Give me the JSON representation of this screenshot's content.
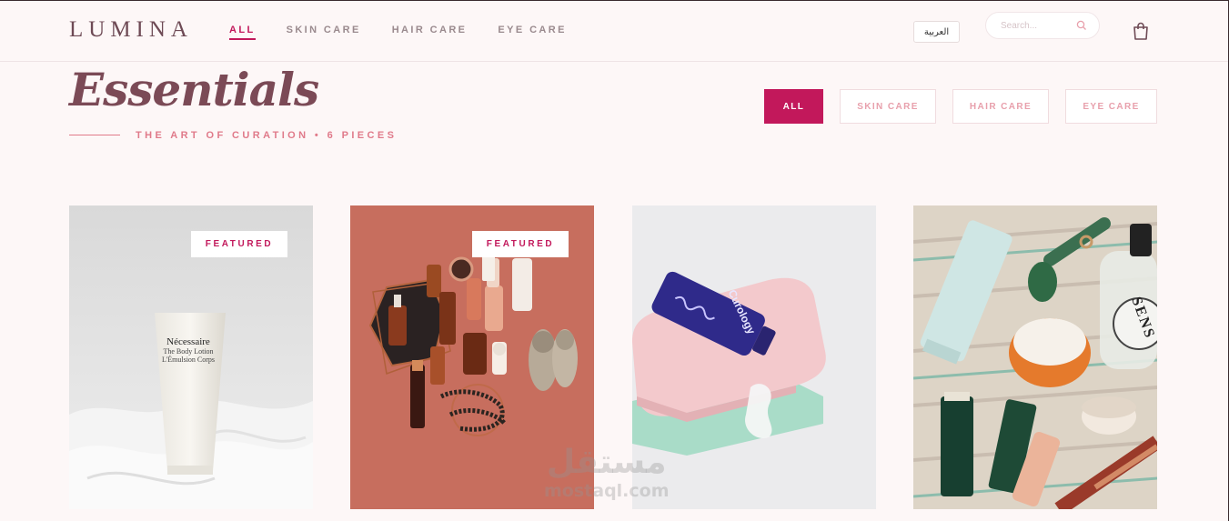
{
  "header": {
    "logo": "LUMINA",
    "nav": [
      "ALL",
      "SKIN CARE",
      "HAIR CARE",
      "EYE CARE"
    ],
    "active_nav": "ALL",
    "language_button": "العربية",
    "search_placeholder": "Search...",
    "icons": {
      "search": "search-icon",
      "cart": "shopping-bag-icon"
    }
  },
  "hero": {
    "title": "Essentials",
    "subtitle": "THE ART OF CURATION • 6 PIECES"
  },
  "filters": [
    "ALL",
    "SKIN CARE",
    "HAIR CARE",
    "EYE CARE"
  ],
  "products": [
    {
      "badge": "FEATURED",
      "image": "white-cream-tube-on-linen",
      "tube_text": [
        "Nécessaire",
        "The Body Lotion",
        "L'Émulsion Corps"
      ]
    },
    {
      "badge": "FEATURED",
      "image": "amber-bottles-flatlay-terracotta"
    },
    {
      "badge": "",
      "image": "blue-serum-bottle-on-pink-tray",
      "bottle_text": "Curology"
    },
    {
      "badge": "",
      "image": "skincare-assortment-on-towel",
      "jar_text": "SENS"
    }
  ],
  "watermark": {
    "arabic": "مستقل",
    "latin": "mostaql.com"
  },
  "colors": {
    "accent": "#c2185b",
    "background": "#fdf7f7",
    "title": "#7b4a56",
    "subtitle": "#e07a8a",
    "filter_text": "#e8a0ac"
  }
}
